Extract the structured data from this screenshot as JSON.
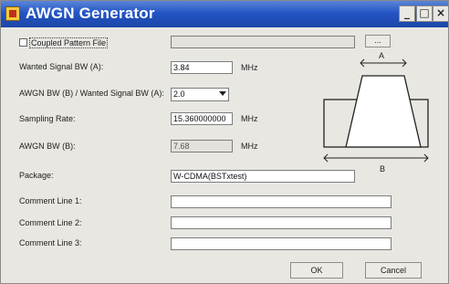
{
  "window": {
    "title": "AWGN Generator",
    "minimize_glyph": "_",
    "maximize_glyph": "□",
    "close_glyph": "×"
  },
  "coupled": {
    "label": "Coupled Pattern File",
    "checked": false,
    "path": "",
    "browse_label": "..."
  },
  "wanted_bw": {
    "label": "Wanted Signal BW (A):",
    "value": "3.84",
    "unit": "MHz"
  },
  "ratio": {
    "label": "AWGN BW (B) / Wanted Signal BW (A):",
    "value": "2.0"
  },
  "sampling": {
    "label": "Sampling Rate:",
    "value": "15.360000000",
    "unit": "MHz"
  },
  "awgn_bw": {
    "label": "AWGN BW (B):",
    "value": "7.68",
    "unit": "MHz"
  },
  "package": {
    "label": "Package:",
    "value": "W-CDMA(BSTxtest)"
  },
  "comments": [
    {
      "label": "Comment Line 1:",
      "value": ""
    },
    {
      "label": "Comment Line 2:",
      "value": ""
    },
    {
      "label": "Comment Line 3:",
      "value": ""
    }
  ],
  "diagram": {
    "label_a": "A",
    "label_b": "B"
  },
  "buttons": {
    "ok": "OK",
    "cancel": "Cancel"
  }
}
